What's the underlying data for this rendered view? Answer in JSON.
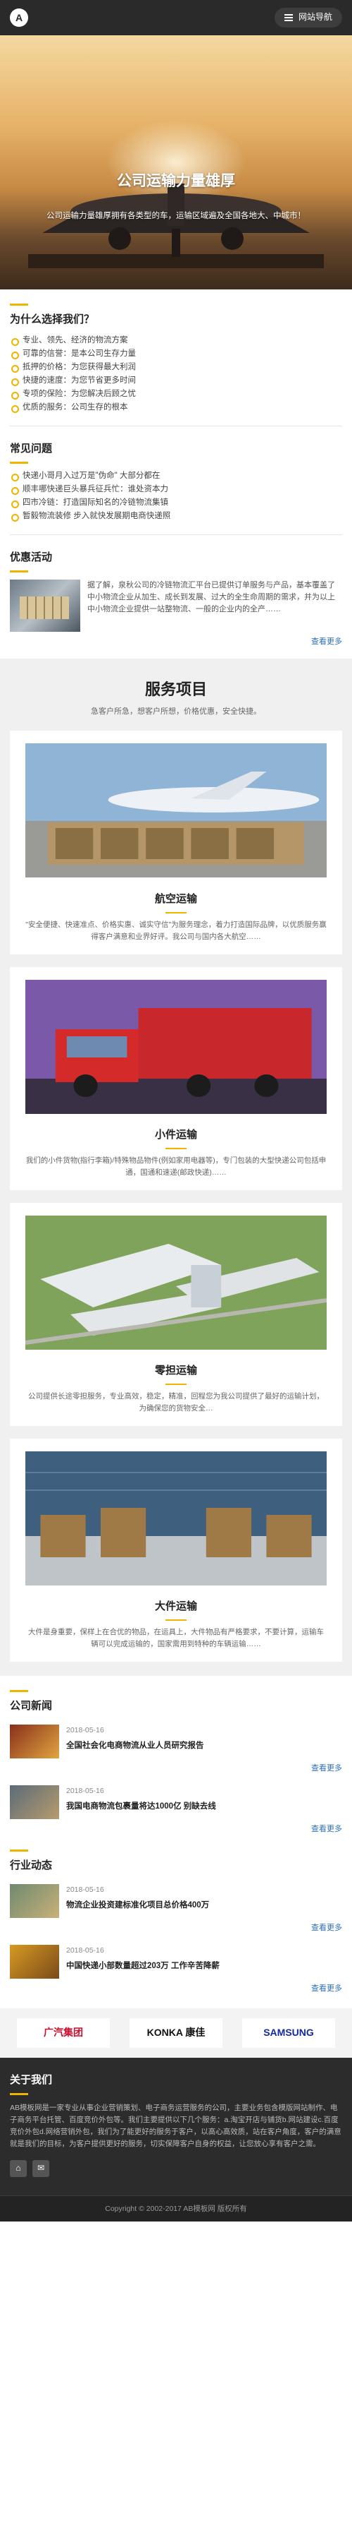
{
  "header": {
    "logo_glyph": "A",
    "nav_label": "网站导航"
  },
  "hero": {
    "title": "公司运输力量雄厚",
    "subtitle": "公司运输力量雄厚拥有各类型的车，运输区域遍及全国各地大、中城市！"
  },
  "why": {
    "title": "为什么选择我们？",
    "items": [
      "专业、领先、经济的物流方案",
      "可靠的信誉：是本公司生存力量",
      "抵押的价格：为您获得最大利润",
      "快捷的速度：为您节省更多时间",
      "专项的保险：为您解决后顾之忧",
      "优质的服务：公司生存的根本"
    ]
  },
  "faq": {
    "title": "常见问题",
    "items": [
      "快递小哥月入过万是\"伪命\" 大部分都在",
      "顺丰哪快递巨头暴兵征兵忙：谁处资本力",
      "四市冷链：打造国际知名的冷链物流集镇",
      "暂毅物流装修 步入就快发展期电商快递照"
    ]
  },
  "promo": {
    "title": "优惠活动",
    "text": "据了解，泉秋公司的冷链物流汇平台已提供订单服务与产品，基本覆盖了中小物流企业从加生、成长到发展、过大的全生命周期的需求，并为以上中小物流企业提供一站整物流、一般的企业内的全产……",
    "more": "查看更多"
  },
  "services": {
    "title": "服务项目",
    "subtitle": "急客户所急，想客户所想，价格优惠，安全快捷。",
    "cards": [
      {
        "name": "航空运输",
        "desc": "\"安全便捷、快速准点、价格实惠、诚实守信\"为服务理念，着力打造国际品牌，以优质服务赢得客户满意和业界好评。我公司与国内各大航空……"
      },
      {
        "name": "小件运输",
        "desc": "我们的小件货物(指行李箱)/特殊物品物件(例如家用电器等)，专门包装的大型快递公司包括申通，国通和速递(邮政快递)……"
      },
      {
        "name": "零担运输",
        "desc": "公司提供长途零担服务，专业高效，稳定，精准，回程您为我公司提供了最好的运输计划，为确保您的货物安全…"
      },
      {
        "name": "大件运输",
        "desc": "大件是身重要，保样上在合优的物品，在运具上，大件物品有严格要求，不要计算，运输车辆可以完成运输的，国家需用到特种的车辆运输……"
      }
    ]
  },
  "news": {
    "title": "公司新闻",
    "more": "查看更多",
    "items": [
      {
        "date": "2018-05-16",
        "title": "全国社会化电商物流从业人员研究报告"
      },
      {
        "date": "2018-05-16",
        "title": "我国电商物流包裹量将达1000亿 别缺去线"
      }
    ]
  },
  "industry": {
    "title": "行业动态",
    "more": "查看更多",
    "items": [
      {
        "date": "2018-05-16",
        "title": "物流企业投资建标准化项目总价格400万"
      },
      {
        "date": "2018-05-16",
        "title": "中国快递小部数量超过203万 工作辛苦降薪"
      }
    ]
  },
  "partners": [
    "广汽集团",
    "KONKA 康佳",
    "SAMSUNG"
  ],
  "about": {
    "title": "关于我们",
    "text": "AB模板网是一家专业从事企业营销策划、电子商务运营服务的公司，主要业务包含模版网站制作、电子商务平台托管、百度竞价外包等。我们主要提供以下几个服务：a.淘宝开店与铺货b.网站建设c.百度竞价外包d.网络营销外包，我们为了能更好的服务于客户，以高心高效质，站在客户角度，客户的满意就是我们的目标，为客户提供更好的服务，切实保障客户自身的权益，让您放心享有客户之需。"
  },
  "footer": {
    "copyright": "Copyright © 2002-2017 AB模板网 版权所有"
  }
}
